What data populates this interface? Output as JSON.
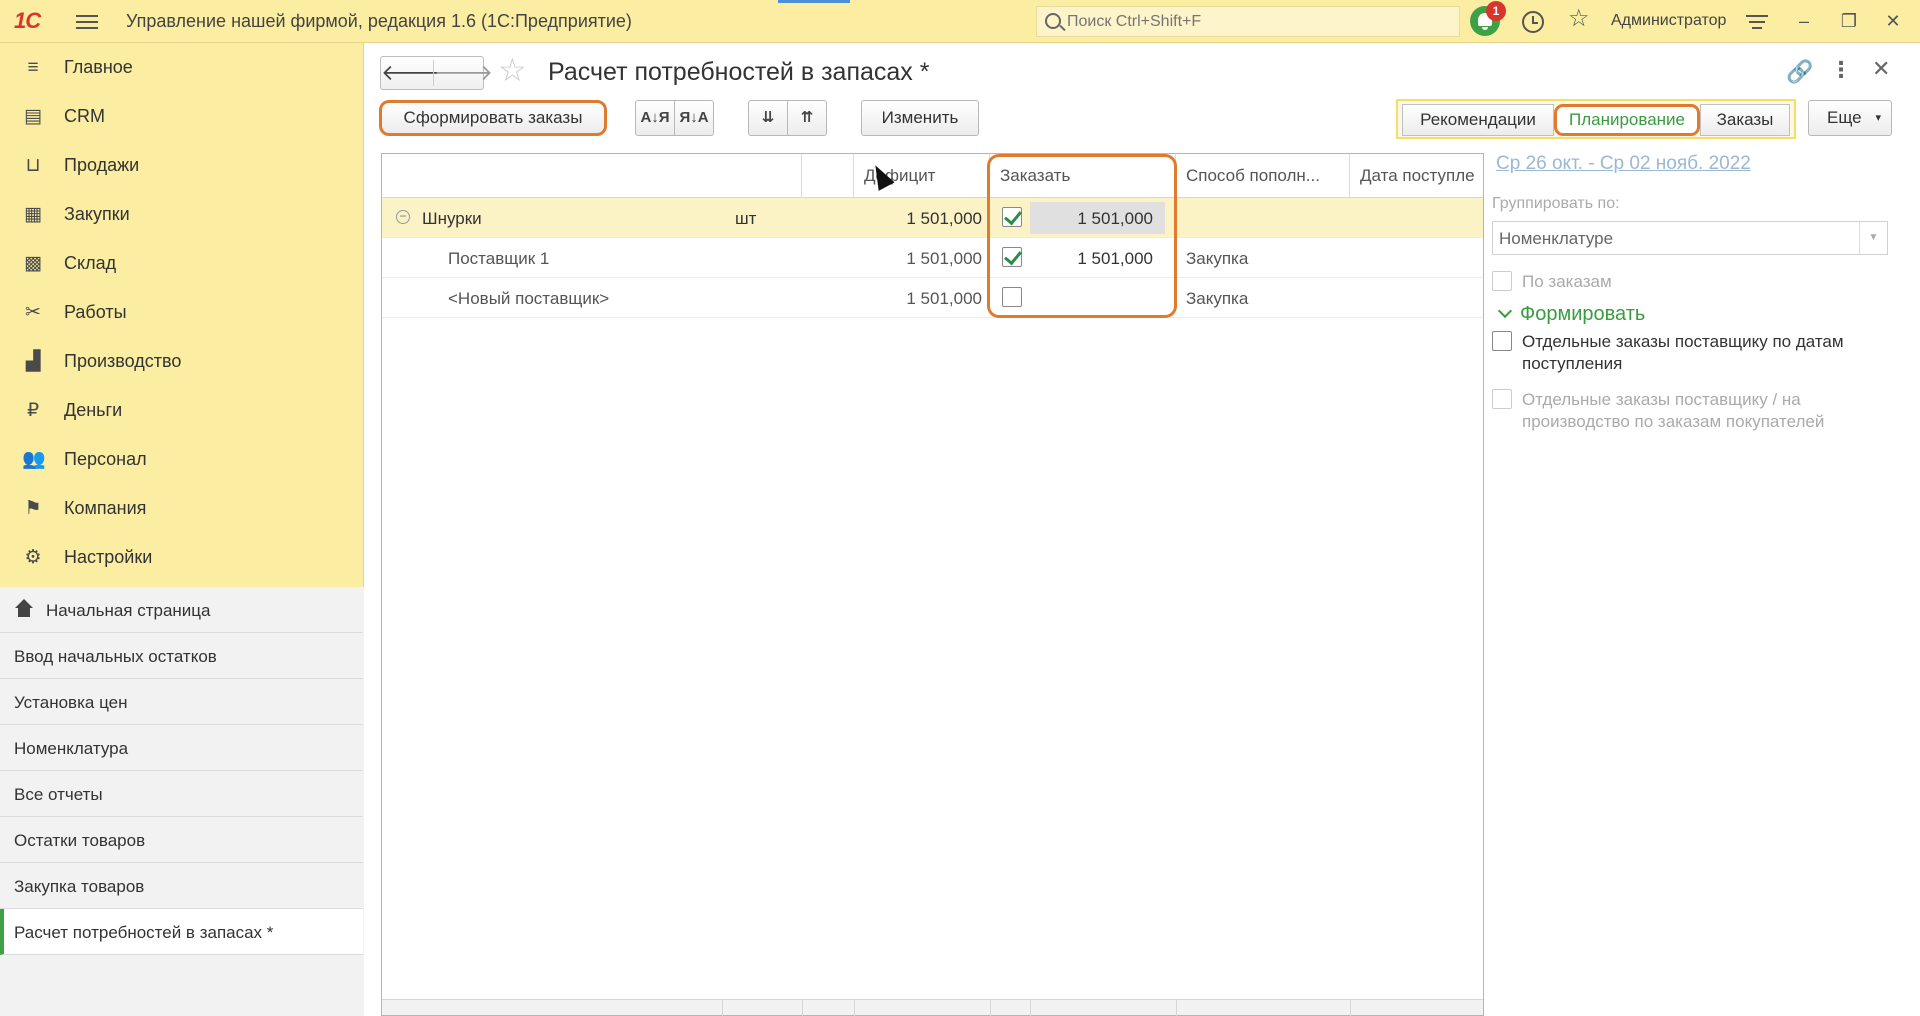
{
  "topbar": {
    "logo": "1С",
    "app_title": "Управление нашей фирмой, редакция 1.6  (1С:Предприятие)",
    "search_placeholder": "Поиск Ctrl+Shift+F",
    "notification_count": "1",
    "user_name": "Администратор",
    "win_minimize": "–",
    "win_restore": "❐",
    "win_close": "✕"
  },
  "sidebar": {
    "items": [
      {
        "label": "Главное",
        "icon": "menu-lines-icon",
        "glyph": "≡"
      },
      {
        "label": "CRM",
        "icon": "crm-icon",
        "glyph": "▤"
      },
      {
        "label": "Продажи",
        "icon": "basket-icon",
        "glyph": "⊔"
      },
      {
        "label": "Закупки",
        "icon": "purchases-icon",
        "glyph": "▦"
      },
      {
        "label": "Склад",
        "icon": "warehouse-icon",
        "glyph": "▩"
      },
      {
        "label": "Работы",
        "icon": "tools-icon",
        "glyph": "✂"
      },
      {
        "label": "Производство",
        "icon": "factory-icon",
        "glyph": "▟"
      },
      {
        "label": "Деньги",
        "icon": "money-icon",
        "glyph": "₽"
      },
      {
        "label": "Персонал",
        "icon": "people-icon",
        "glyph": "👥"
      },
      {
        "label": "Компания",
        "icon": "flag-icon",
        "glyph": "⚑"
      },
      {
        "label": "Настройки",
        "icon": "gear-icon",
        "glyph": "⚙"
      }
    ],
    "history": [
      "Начальная страница",
      "Ввод начальных остатков",
      "Установка цен",
      "Номенклатура",
      "Все отчеты",
      "Остатки товаров",
      "Закупка товаров",
      "Расчет потребностей в запасах *"
    ]
  },
  "form": {
    "back": "🡐",
    "forward": "🡒",
    "title": "Расчет потребностей в запасах *",
    "link_glyph": "🔗",
    "more_glyph": "⋮",
    "close_glyph": "✕",
    "toolbar": {
      "create_orders": "Сформировать заказы",
      "sort_asc": "А↓Я",
      "sort_desc": "Я↓А",
      "expand_all": "⇊",
      "collapse_all": "⇈",
      "change": "Изменить"
    },
    "tabs": [
      "Рекомендации",
      "Планирование",
      "Заказы"
    ],
    "more": "Еще",
    "more_caret": "▾"
  },
  "grid": {
    "columns": [
      "",
      "",
      "Дефицит",
      "Заказать",
      "Способ пополн...",
      "Дата поступле"
    ],
    "rows": [
      {
        "name": "Шнурки",
        "unit": "шт",
        "deficit": "1 501,000",
        "checked": true,
        "order_qty": "1 501,000",
        "method": "",
        "selected": true,
        "group": true
      },
      {
        "name": "Поставщик 1",
        "unit": "",
        "deficit": "1 501,000",
        "checked": true,
        "order_qty": "1 501,000",
        "method": "Закупка",
        "selected": false,
        "group": false
      },
      {
        "name": "<Новый поставщик>",
        "unit": "",
        "deficit": "1 501,000",
        "checked": false,
        "order_qty": "",
        "method": "Закупка",
        "selected": false,
        "group": false
      }
    ]
  },
  "panel": {
    "period": "Ср 26 окт. - Ср 02 нояб. 2022",
    "group_by_label": "Группировать по:",
    "group_by_value": "Номенклатуре",
    "by_orders": "По заказам",
    "section_title": "Формировать",
    "opt_separate_by_dates": "Отдельные заказы поставщику по датам поступления",
    "opt_separate_by_customer": "Отдельные заказы поставщику / на производство по заказам покупателей"
  },
  "colors": {
    "topbar_bg": "#fbeda1",
    "accent_orange": "#e07a2e",
    "accent_green": "#3a9b3f",
    "selected_row": "#fbf2c5"
  }
}
